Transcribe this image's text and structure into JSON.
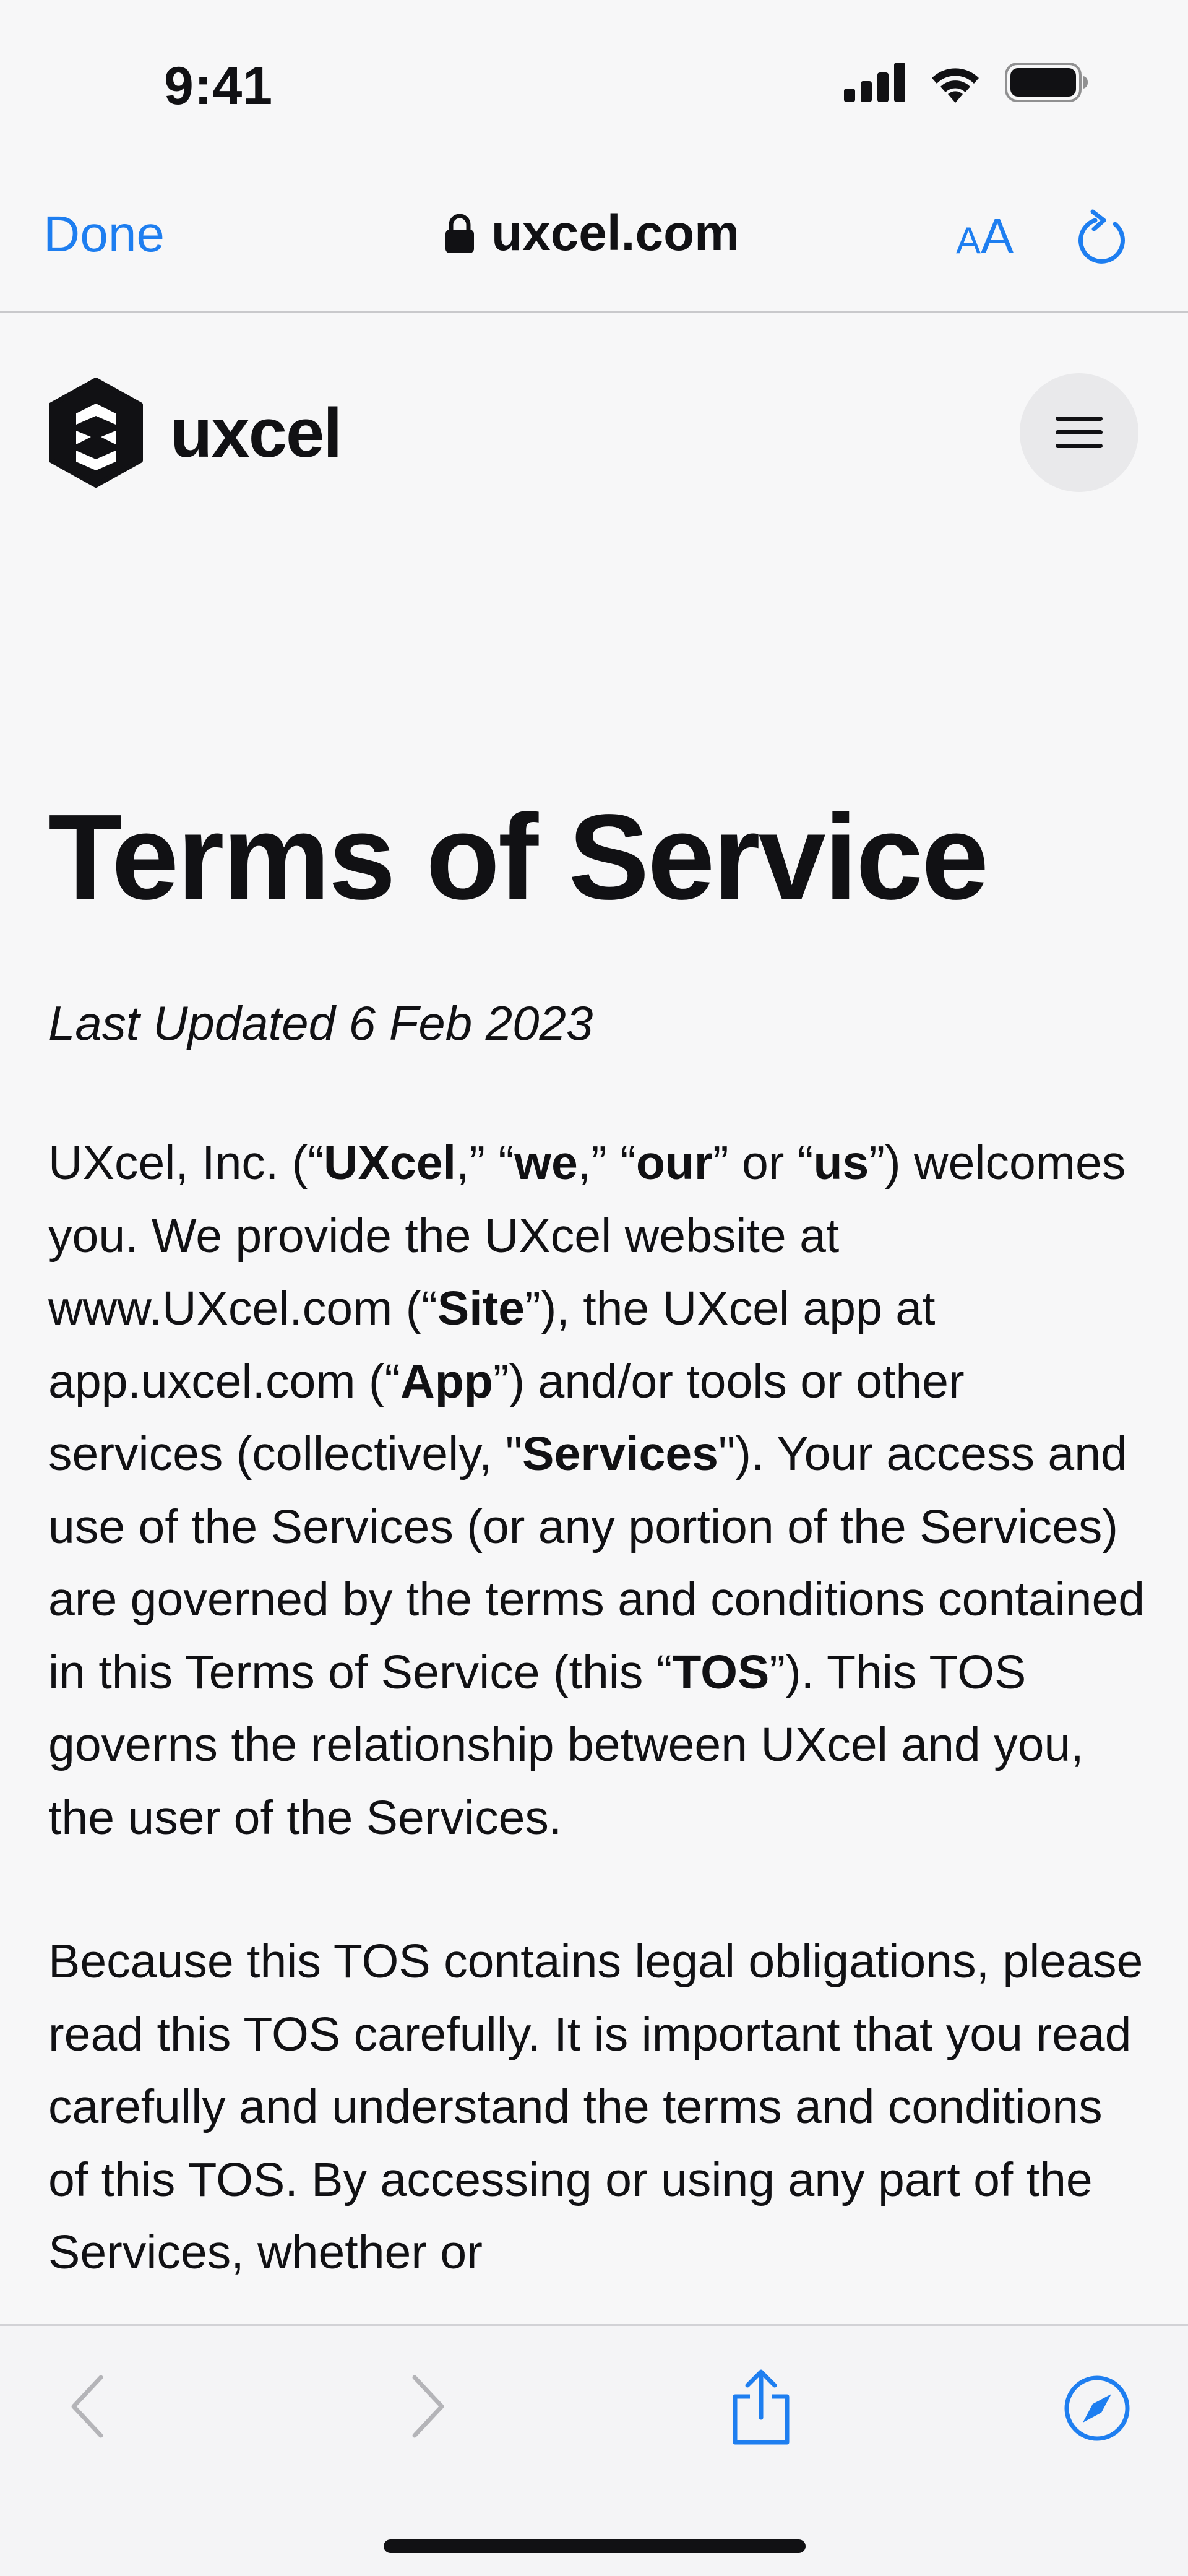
{
  "status_bar": {
    "time": "9:41"
  },
  "browser": {
    "done_label": "Done",
    "url": "uxcel.com",
    "text_size_small": "A",
    "text_size_big": "A"
  },
  "site": {
    "logo_text": "uxcel"
  },
  "page": {
    "title": "Terms of Service",
    "last_updated": "Last Updated 6 Feb 2023",
    "p1": {
      "t1": "UXcel, Inc. (“",
      "b1": "UXcel",
      "t2": ",” “",
      "b2": "we",
      "t3": ",” “",
      "b3": "our",
      "t4": "” or “",
      "b4": "us",
      "t5": "”) welcomes you.  We provide the UXcel website at www.UXcel.com  (“",
      "b5": "Site",
      "t6": "”), the UXcel app at app.uxcel.com (“",
      "b6": "App",
      "t7": "”) and/or tools or other services (collectively, \"",
      "b7": "Services",
      "t8": "\").  Your access and use of the Services (or any portion of the Services) are governed by the terms and conditions contained in this Terms of Service (this “",
      "b8": "TOS",
      "t9": "”).  This TOS governs the relationship between UXcel and you, the user of the Services."
    },
    "p2": "Because this TOS contains legal obligations, please read this TOS carefully.  It is important that you read carefully and understand the terms and conditions of this TOS.  By accessing or using any part of the Services, whether or"
  },
  "colors": {
    "accent": "#1e7ef0",
    "disabled": "#b4b4b8",
    "text": "#111114"
  }
}
